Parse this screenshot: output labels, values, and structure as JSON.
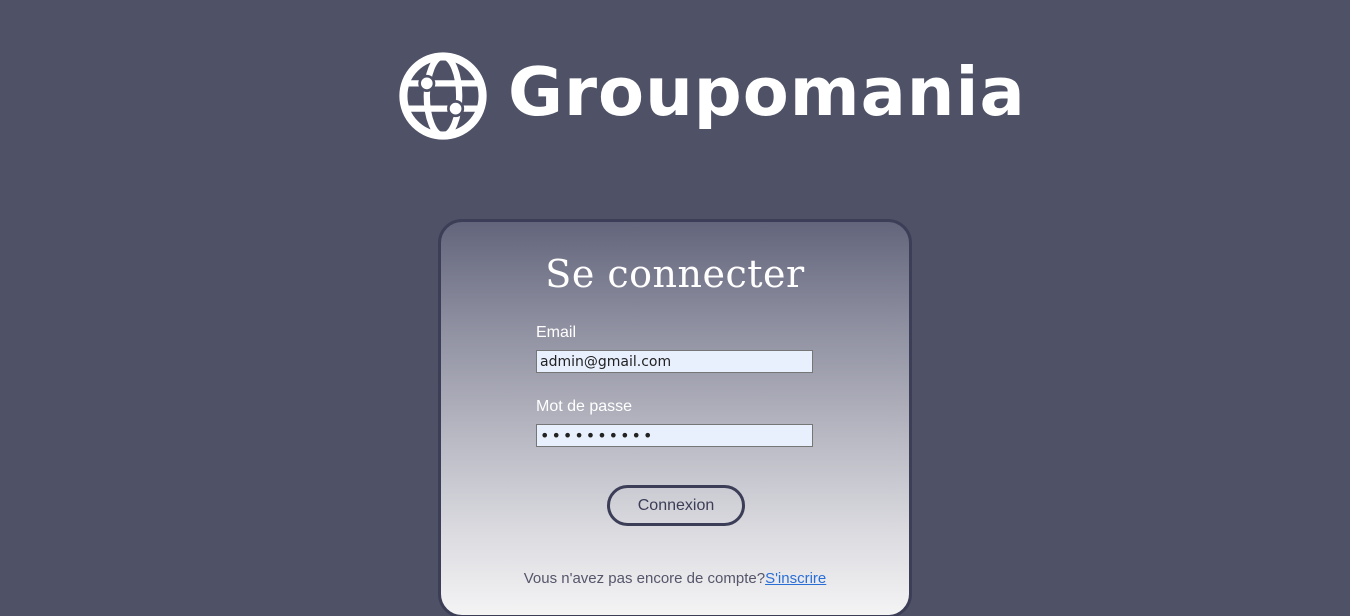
{
  "header": {
    "brand_name": "Groupomania",
    "logo_icon": "globe-icon",
    "brand_color": "#ffffff"
  },
  "login": {
    "title": "Se connecter",
    "email_label": "Email",
    "email_value": "admin@gmail.com",
    "password_label": "Mot de passe",
    "password_value": "••••••••••",
    "submit_label": "Connexion",
    "signup_prompt": "Vous n'avez pas encore de compte?",
    "signup_link": "S'inscrire"
  },
  "colors": {
    "background": "#4f5166",
    "accent": "#3c3d57",
    "input_bg": "#e8f0fe",
    "link": "#2a6fd6"
  }
}
